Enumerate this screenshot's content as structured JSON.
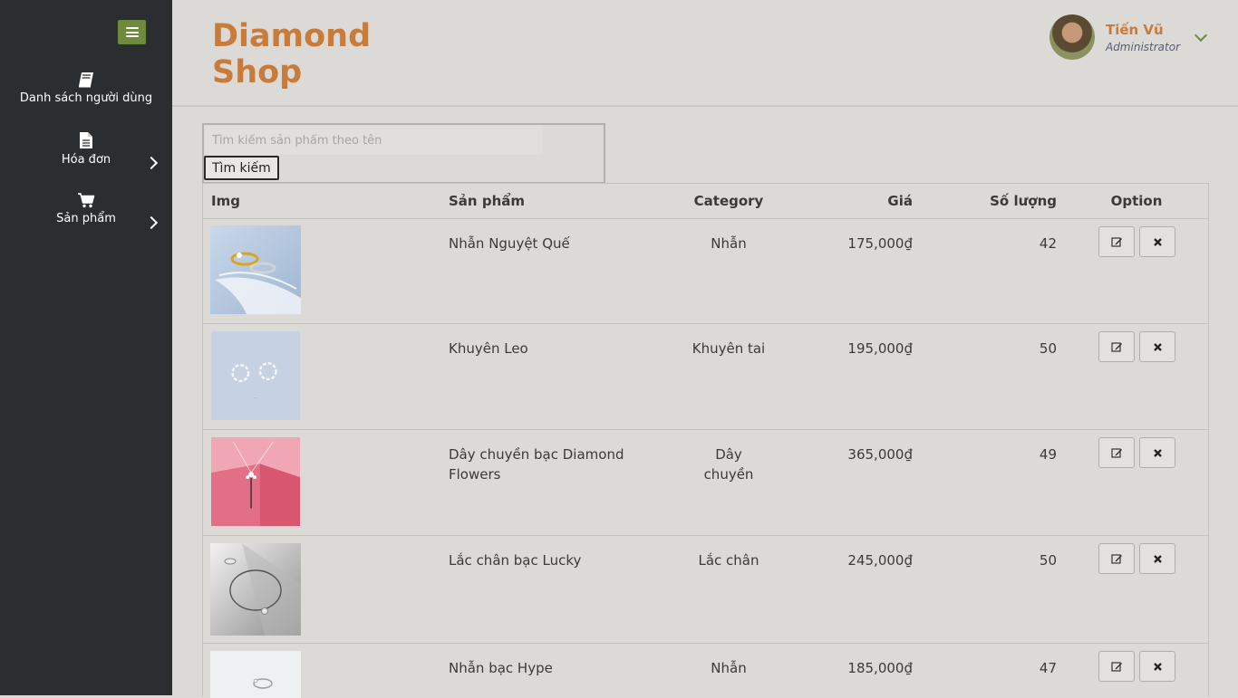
{
  "brand": {
    "line1": "Diamond",
    "line2": "Shop"
  },
  "user": {
    "name": "Tiến Vũ",
    "role": "Administrator"
  },
  "sidebar": {
    "items": [
      {
        "label": "Danh sách người dùng",
        "icon": "book-icon"
      },
      {
        "label": "Hóa đơn",
        "icon": "file-icon"
      },
      {
        "label": "Sản phẩm",
        "icon": "cart-icon"
      }
    ]
  },
  "search": {
    "placeholder": "Tìm kiếm sản phẩm theo tên",
    "button_label": "Tìm kiếm"
  },
  "table": {
    "headers": {
      "img": "Img",
      "product": "Sản phẩm",
      "category": "Category",
      "price": "Giá",
      "quantity": "Số lượng",
      "option": "Option"
    },
    "rows": [
      {
        "name": "Nhẫn Nguyệt Quế",
        "category": "Nhẫn",
        "price": "175,000₫",
        "quantity": "42"
      },
      {
        "name": "Khuyên Leo",
        "category": "Khuyên tai",
        "price": "195,000₫",
        "quantity": "50"
      },
      {
        "name": "Dây chuyền bạc Diamond Flowers",
        "category": "Dây chuyền",
        "price": "365,000₫",
        "quantity": "49"
      },
      {
        "name": "Lắc chân bạc Lucky",
        "category": "Lắc chân",
        "price": "245,000₫",
        "quantity": "50"
      },
      {
        "name": "Nhẫn bạc Hype",
        "category": "Nhẫn",
        "price": "185,000₫",
        "quantity": "47"
      }
    ]
  },
  "colors": {
    "accent": "#c97b3a",
    "sidebar": "#2b2e31",
    "toggle": "#6e8b3d"
  }
}
